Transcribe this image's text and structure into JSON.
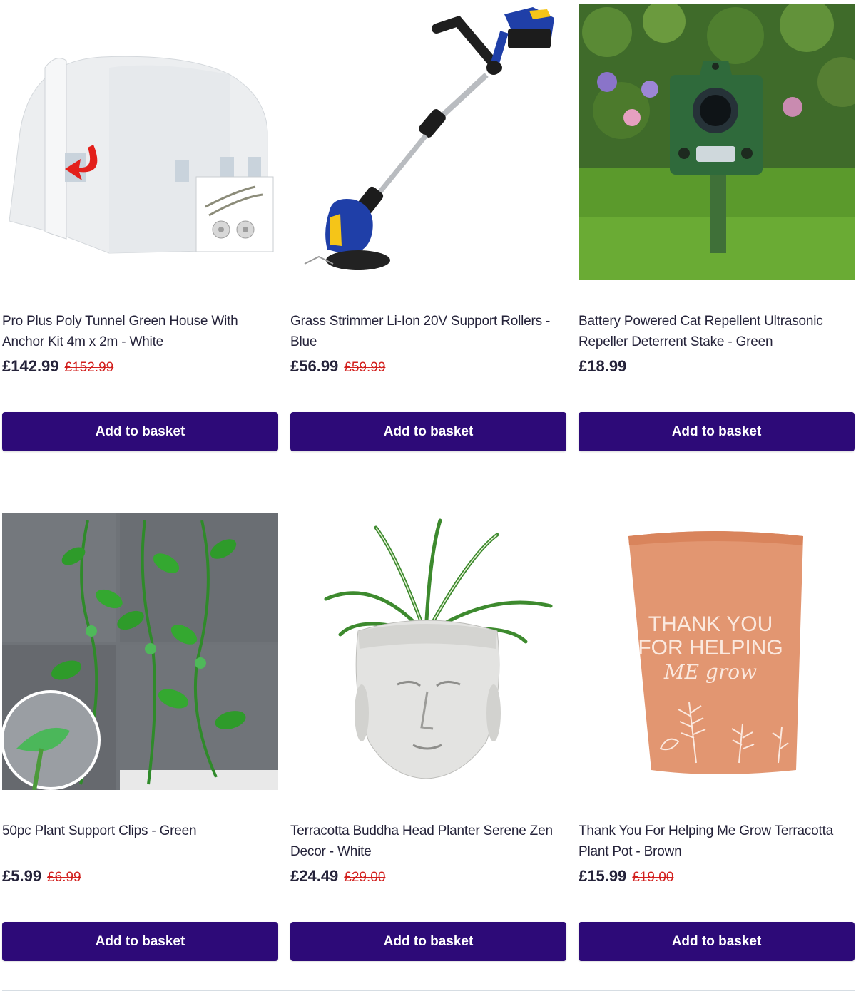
{
  "rows": [
    {
      "products": [
        {
          "title": "Pro Plus Poly Tunnel Green House With Anchor Kit 4m x 2m - White",
          "price": "£142.99",
          "old_price": "£152.99",
          "button": "Add to basket",
          "image": "polytunnel-greenhouse"
        },
        {
          "title": "Grass Strimmer Li-Ion 20V Support Rollers - Blue",
          "price": "£56.99",
          "old_price": "£59.99",
          "button": "Add to basket",
          "image": "grass-strimmer"
        },
        {
          "title": "Battery Powered Cat Repellent Ultrasonic Repeller Deterrent Stake - Green",
          "price": "£18.99",
          "old_price": "",
          "button": "Add to basket",
          "image": "cat-repeller"
        }
      ]
    },
    {
      "products": [
        {
          "title": "50pc Plant Support Clips - Green",
          "price": "£5.99",
          "old_price": "£6.99",
          "button": "Add to basket",
          "image": "plant-support-clips"
        },
        {
          "title": "Terracotta Buddha Head Planter Serene Zen Decor - White",
          "price": "£24.49",
          "old_price": "£29.00",
          "button": "Add to basket",
          "image": "buddha-head-planter"
        },
        {
          "title": "Thank You For Helping Me Grow Terracotta Plant Pot - Brown",
          "price": "£15.99",
          "old_price": "£19.00",
          "button": "Add to basket",
          "image": "terracotta-pot",
          "pot_text": [
            "THANK YOU",
            "FOR HELPING",
            "ME grow"
          ]
        }
      ]
    }
  ],
  "colors": {
    "button_bg": "#2d0a78",
    "old_price": "#d2201e",
    "divider": "#d6dde3"
  }
}
